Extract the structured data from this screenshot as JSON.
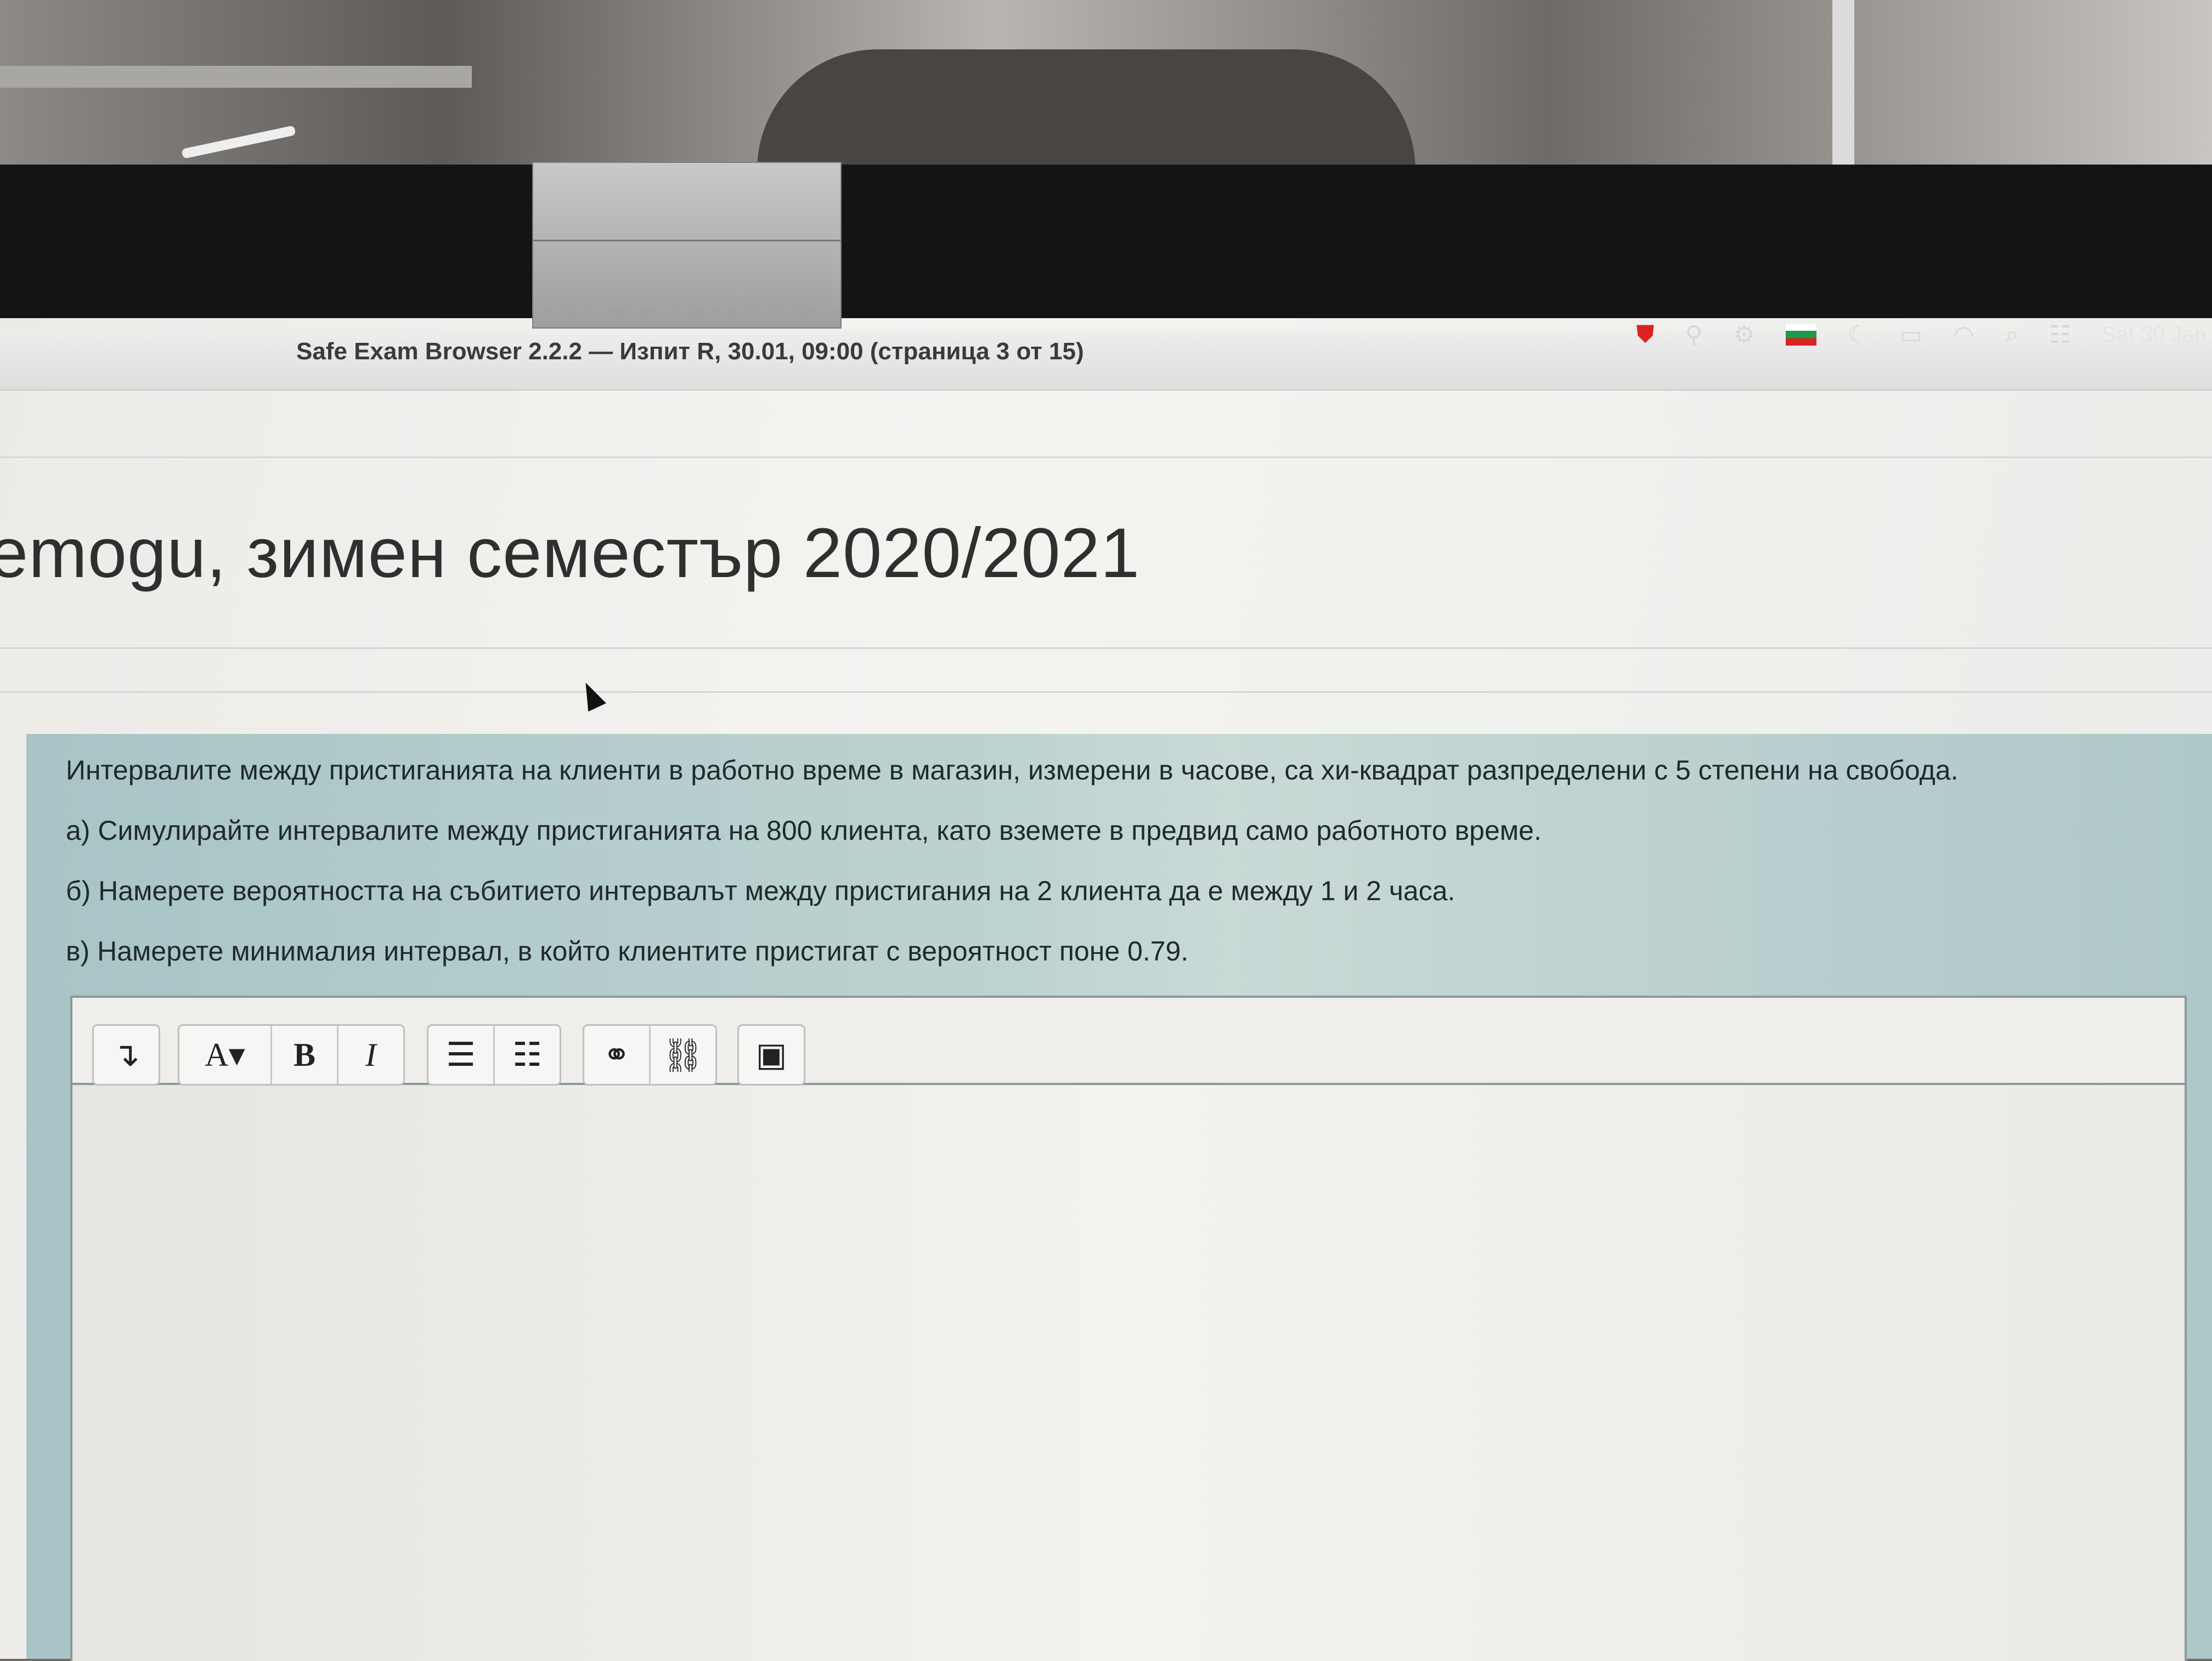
{
  "window": {
    "title": "Safe Exam Browser 2.2.2  —  Изпит R, 30.01, 09:00 (страница 3 от 15)"
  },
  "menubar": {
    "clock": "Sat 30 Jan",
    "icons": [
      "antivirus-icon",
      "search-icon",
      "settings-icon",
      "flag-icon",
      "moon-icon",
      "battery-icon",
      "wifi-icon",
      "spotlight-icon",
      "control-center-icon"
    ]
  },
  "page": {
    "heading": "emogu, зимен семестър 2020/2021"
  },
  "question": {
    "intro": "Интервалите между пристиганията на клиенти в работно време в магазин, измерени в часове, са хи-квадрат разпределени с 5 степени на свобода.",
    "part_a": "а) Симулирайте интервалите между пристиганията на 800 клиента, като вземете в предвид само работното време.",
    "part_b": "б) Намерете вероятността на събитието интервалът между пристигания на 2 клиента да е между 1 и 2 часа.",
    "part_c": "в) Намерете минималия интервал, в който клиентите пристигат с вероятност поне 0.79."
  },
  "editor": {
    "toolbar": {
      "collapse": "↴",
      "font": "A▾",
      "bold": "B",
      "italic": "I",
      "bullet_list": "☰",
      "numbered_list": "☷",
      "link": "⚭",
      "unlink": "⛓",
      "image": "▣"
    },
    "content": ""
  }
}
